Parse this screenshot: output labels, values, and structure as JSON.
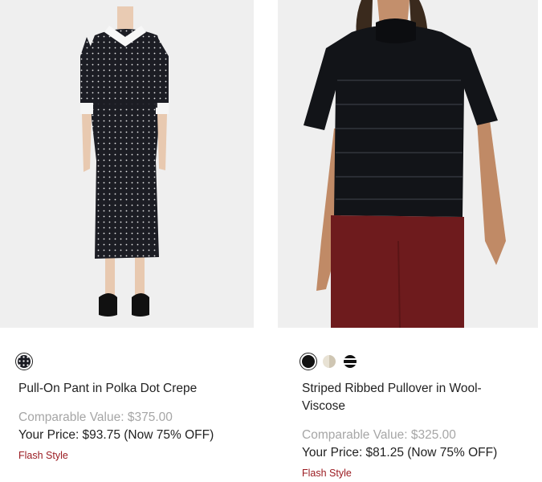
{
  "products": [
    {
      "image_alt": "Pull-On Pant in Polka Dot Crepe",
      "swatches": [
        {
          "name": "polka-dot-black",
          "color": "#1a1b22",
          "selected": true
        }
      ],
      "name": "Pull-On Pant in Polka Dot Crepe",
      "comparable_value": "Comparable Value: $375.00",
      "your_price": "Your Price: $93.75 (Now 75% OFF)",
      "badge": "Flash Style"
    },
    {
      "image_alt": "Striped Ribbed Pullover in Wool-Viscose",
      "swatches": [
        {
          "name": "black",
          "color": "#111111",
          "selected": true
        },
        {
          "name": "beige",
          "color": "#e8e2d4",
          "selected": false
        },
        {
          "name": "black-stripe",
          "color": "#111111",
          "selected": false
        }
      ],
      "name": "Striped Ribbed Pullover in Wool-Viscose",
      "comparable_value": "Comparable Value: $325.00",
      "your_price": "Your Price: $81.25 (Now 75% OFF)",
      "badge": "Flash Style"
    }
  ],
  "colors": {
    "image_bg": "#efefef",
    "badge": "#9b1c22",
    "muted": "#a6a6a6"
  }
}
